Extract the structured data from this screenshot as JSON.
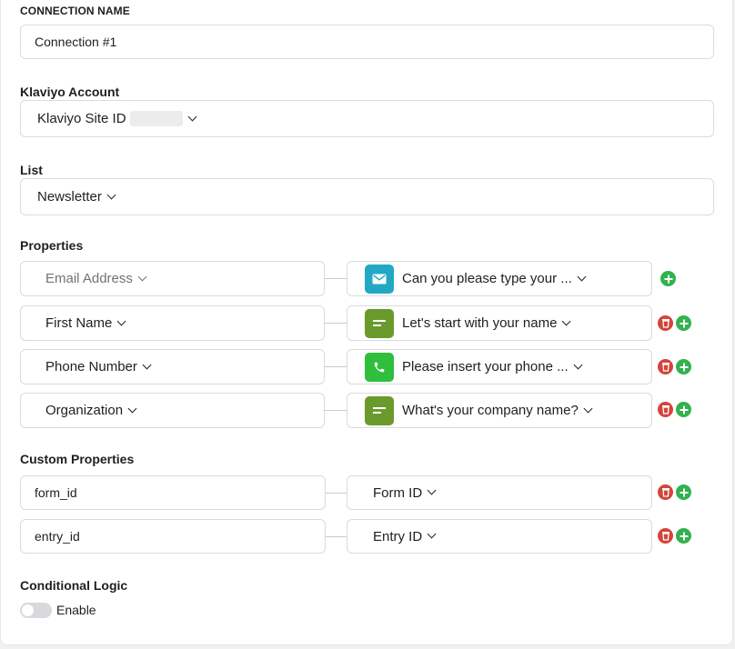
{
  "connection_name": {
    "label": "CONNECTION NAME",
    "value": "Connection #1"
  },
  "klaviyo_account": {
    "label": "Klaviyo Account",
    "value": "Klaviyo Site ID"
  },
  "list": {
    "label": "List",
    "value": "Newsletter"
  },
  "properties": {
    "label": "Properties",
    "rows": [
      {
        "field": "Email Address",
        "field_placeholder": true,
        "icon": "email-icon",
        "value": "Can you please type your ...",
        "delete": false
      },
      {
        "field": "First Name",
        "field_placeholder": false,
        "icon": "text-icon",
        "value": "Let's start with your name",
        "delete": true
      },
      {
        "field": "Phone Number",
        "field_placeholder": false,
        "icon": "phone-icon",
        "value": "Please insert your phone ...",
        "delete": true
      },
      {
        "field": "Organization",
        "field_placeholder": false,
        "icon": "text-icon",
        "value": "What's your company name?",
        "delete": true
      }
    ]
  },
  "custom_properties": {
    "label": "Custom Properties",
    "rows": [
      {
        "key": "form_id",
        "value": "Form ID"
      },
      {
        "key": "entry_id",
        "value": "Entry ID"
      }
    ]
  },
  "conditional_logic": {
    "label": "Conditional Logic",
    "toggle_label": "Enable",
    "enabled": false
  },
  "colors": {
    "email": "#22a8c5",
    "text": "#6b9a2c",
    "phone": "#2fbf3c",
    "add": "#31b24e",
    "delete": "#d3453b"
  }
}
